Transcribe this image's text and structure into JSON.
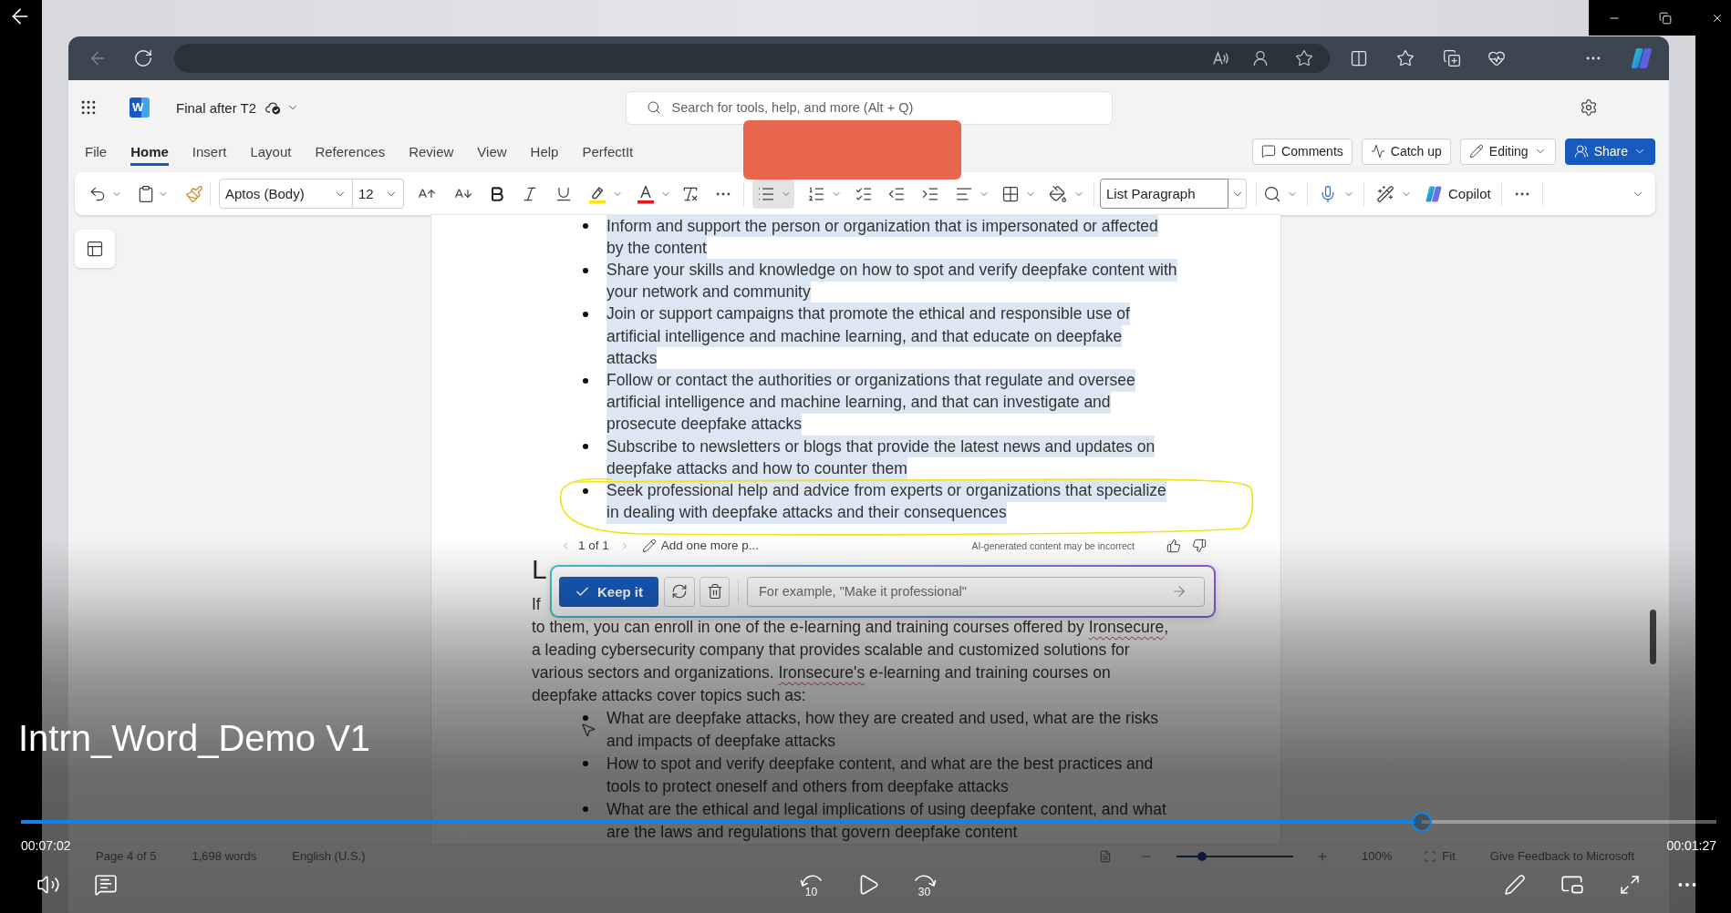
{
  "word": {
    "header": {
      "logo_letter": "W",
      "doc_title": "Final after T2",
      "search_placeholder": "Search for tools, help, and more (Alt + Q)"
    },
    "tabs": [
      {
        "label": "File",
        "selected": false
      },
      {
        "label": "Home",
        "selected": true
      },
      {
        "label": "Insert",
        "selected": false
      },
      {
        "label": "Layout",
        "selected": false
      },
      {
        "label": "References",
        "selected": false
      },
      {
        "label": "Review",
        "selected": false
      },
      {
        "label": "View",
        "selected": false
      },
      {
        "label": "Help",
        "selected": false
      },
      {
        "label": "PerfectIt",
        "selected": false
      }
    ],
    "actions": [
      {
        "label": "Comments",
        "kind": "plain"
      },
      {
        "label": "Catch up",
        "kind": "plain"
      },
      {
        "label": "Editing",
        "kind": "menu"
      },
      {
        "label": "Share",
        "kind": "primary"
      }
    ],
    "ribbon": {
      "font": "Aptos (Body)",
      "size": "12",
      "bullets": {
        "on": true
      },
      "style": "List Paragraph",
      "copilot": "Copilot"
    },
    "document": {
      "list_1": [
        {
          "text": "Inform and support the person or organization that is impersonated or affected\nby the content",
          "highlighted": true
        },
        {
          "text": "Share your skills and knowledge on how to spot and verify deepfake content with\nyour network and community",
          "highlighted": true
        },
        {
          "text": "Join or support campaigns that promote the ethical and responsible use of\nartificial intelligence and machine learning, and that educate on deepfake\nattacks",
          "highlighted": true
        },
        {
          "text": "Follow or contact the authorities or organizations that regulate and oversee\nartificial intelligence and machine learning, and that can investigate and\nprosecute deepfake attacks",
          "highlighted": true
        },
        {
          "text": "Subscribe to newsletters or blogs that provide the latest news and updates on\ndeepfake attacks and how to counter them",
          "highlighted": true
        },
        {
          "text": "Seek professional help and advice from experts or organizations that specialize\nin dealing with deepfake attacks and their consequences",
          "highlighted": true
        }
      ],
      "ai_bar": {
        "pager": "1 of 1",
        "add_more": "Add one more p...",
        "disclaimer": "AI-generated content may be incorrect"
      },
      "prompt": {
        "keep": "Keep it",
        "placeholder": "For example, \"Make it professional\""
      },
      "heading": "L",
      "paragraph_start": "If",
      "paragraph": [
        {
          "text": "to them, you can enroll in one of the e-learning and training courses offered by ",
          "misspelled": false
        },
        {
          "text": "Ironsecure",
          "misspelled": true
        },
        {
          "text": ",\na leading cybersecurity company that provides scalable and customized solutions for\nvarious sectors and organizations. ",
          "misspelled": false
        },
        {
          "text": "Ironsecure's",
          "misspelled": true
        },
        {
          "text": " e-learning and training courses on\ndeepfake attacks cover topics such as:",
          "misspelled": false
        }
      ],
      "list_2": [
        {
          "text": "What are deepfake attacks, how they are created and used, what are the risks\nand impacts of deepfake attacks",
          "highlighted": false
        },
        {
          "text": "How to spot and verify deepfake content, and what are the best practices and\ntools to protect oneself and others from deepfake attacks",
          "highlighted": false
        },
        {
          "text": "What are the ethical and legal implications of using deepfake content, and what\nare the laws and regulations that govern deepfake content",
          "highlighted": false
        }
      ]
    },
    "status_bar": {
      "page": "Page 4 of 5",
      "words": "1,698 words",
      "language": "English (U.S.)",
      "zoom_slider": {
        "level": 0.22
      },
      "zoom": "100%",
      "fit": "Fit",
      "feedback": "Give Feedback to Microsoft"
    }
  },
  "player": {
    "title": "Intrn_Word_Demo V1",
    "progress": {
      "level": 0.826
    },
    "elapsed": "00:07:02",
    "remaining": "00:01:27",
    "skip_back": "10",
    "skip_forward": "30"
  }
}
